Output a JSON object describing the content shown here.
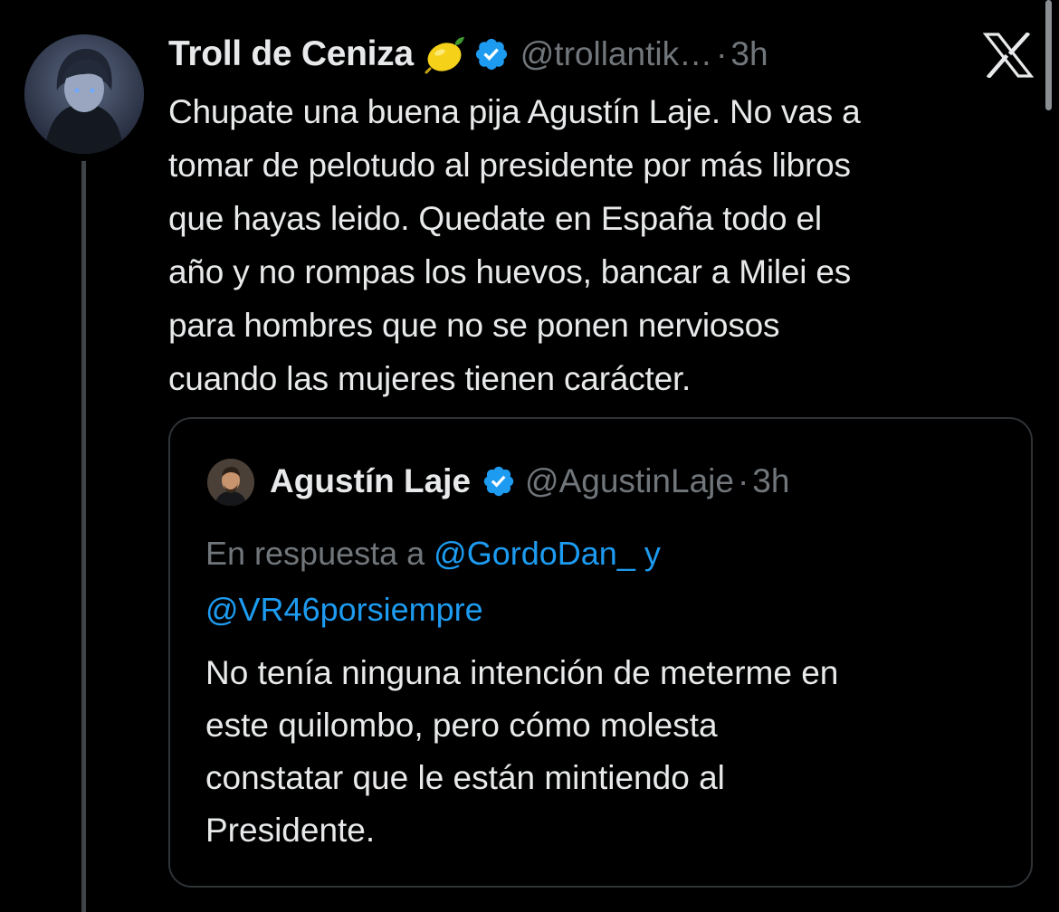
{
  "tweet": {
    "author_name": "Troll de Ceniza",
    "author_handle": "@trollantik…",
    "separator": "·",
    "time": "3h",
    "emoji": "lemon-emoji",
    "text_lines": [
      "Chupate una buena pija Agustín Laje. No vas a",
      "tomar de pelotudo al presidente por más libros",
      "que hayas leido. Quedate en España todo el",
      "año y no rompas los huevos, bancar a Milei es",
      "para hombres que no se ponen nerviosos",
      "cuando las mujeres tienen carácter."
    ]
  },
  "quote": {
    "author_name": "Agustín Laje",
    "author_handle": "@AgustinLaje",
    "separator": "·",
    "time": "3h",
    "reply_prefix": "En respuesta a ",
    "reply_mention_1": "@GordoDan_",
    "reply_conjunction": " y",
    "reply_mention_2": "@VR46porsiempre",
    "text_lines": [
      "No tenía ninguna intención de meterme en",
      "este quilombo, pero cómo molesta",
      "constatar que le están mintiendo al",
      "Presidente."
    ]
  },
  "icons": {
    "verified": "verified-badge-icon",
    "close": "x-logo-icon"
  },
  "colors": {
    "background": "#000000",
    "text_primary": "#e7e9ea",
    "text_secondary": "#71767b",
    "accent": "#1d9bf0",
    "border": "#2f3336"
  }
}
